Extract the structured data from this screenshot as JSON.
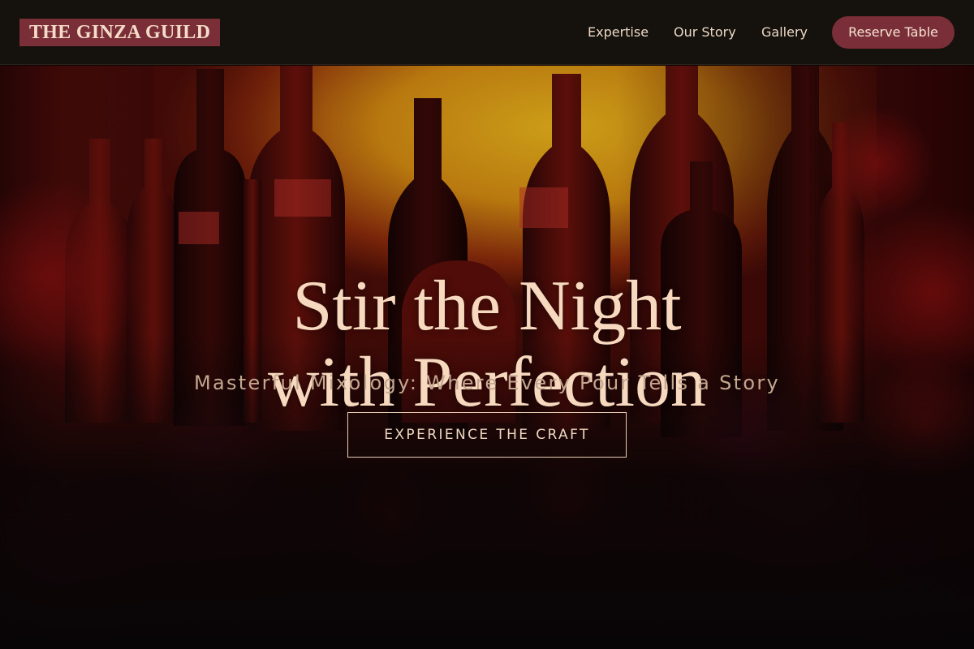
{
  "header": {
    "logo": "THE GINZA GUILD",
    "nav": [
      "Expertise",
      "Our Story",
      "Gallery"
    ],
    "reserve_label": "Reserve Table"
  },
  "hero": {
    "headline_line1": "Stir the Night",
    "headline_line2": "with Perfection",
    "subtitle": "Masterful Mixology: Where Every Pour Tells a Story",
    "cta_label": "EXPERIENCE THE CRAFT",
    "background_image": "bar-bottles-backlit-photo"
  },
  "colors": {
    "header_bg": "#15110c",
    "accent": "#7a2e38",
    "headline": "#f7d9bf",
    "subtitle": "#c4a78f",
    "backlight": "#e0a21a"
  }
}
